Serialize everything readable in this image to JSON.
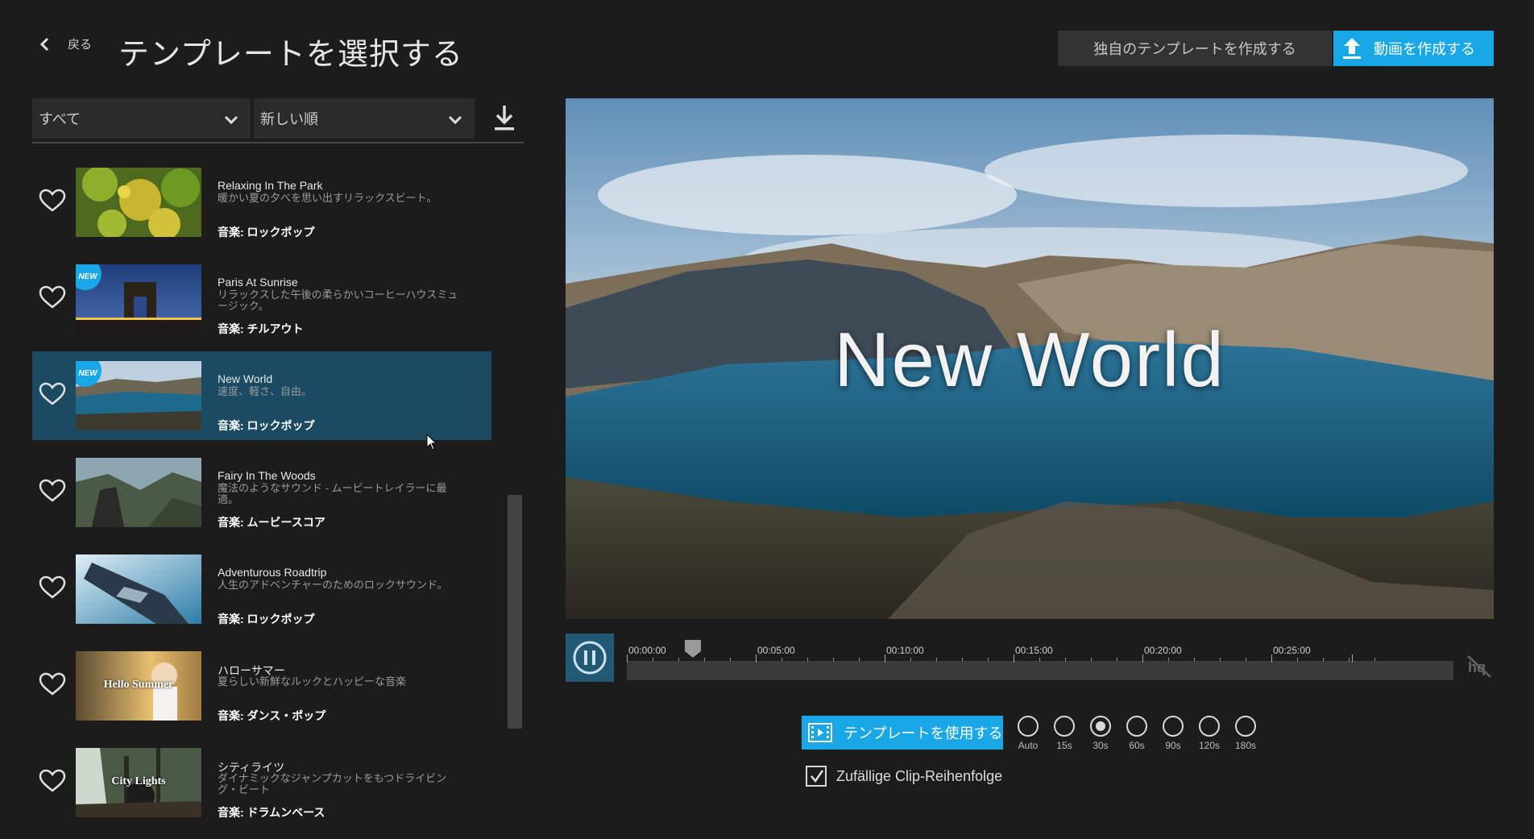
{
  "header": {
    "back_label": "戻る",
    "title": "テンプレートを選択する",
    "own_template_button": "独自のテンプレートを作成する",
    "create_video_button": "動画を作成する"
  },
  "filters": {
    "category": "すべて",
    "sort": "新しい順"
  },
  "templates": [
    {
      "name": "Relaxing In The Park",
      "desc": "暖かい夏の夕べを思い出すリラックスビート。",
      "music": "音楽: ロックポップ",
      "is_new": false,
      "selected": false,
      "thumb_text": ""
    },
    {
      "name": "Paris At Sunrise",
      "desc": "リラックスした午後の柔らかいコーヒーハウスミュージック。",
      "music": "音楽: チルアウト",
      "is_new": true,
      "selected": false,
      "thumb_text": ""
    },
    {
      "name": "New World",
      "desc": "速度、軽さ、自由。",
      "music": "音楽: ロックポップ",
      "is_new": true,
      "selected": true,
      "thumb_text": ""
    },
    {
      "name": "Fairy In The Woods",
      "desc": "魔法のようなサウンド - ムービートレイラーに最適。",
      "music": "音楽: ムービースコア",
      "is_new": false,
      "selected": false,
      "thumb_text": ""
    },
    {
      "name": "Adventurous Roadtrip",
      "desc": "人生のアドベンチャーのためのロックサウンド。",
      "music": "音楽: ロックポップ",
      "is_new": false,
      "selected": false,
      "thumb_text": ""
    },
    {
      "name": "ハローサマー",
      "desc": "夏らしい新鮮なルックとハッピーな音楽",
      "music": "音楽: ダンス・ポップ",
      "is_new": false,
      "selected": false,
      "thumb_text": "Hello Summer"
    },
    {
      "name": "シティライツ",
      "desc": "ダイナミックなジャンプカットをもつドライビング・ビート",
      "music": "音楽: ドラムンベース",
      "is_new": false,
      "selected": false,
      "thumb_text": "City Lights"
    }
  ],
  "new_badge": "NEW",
  "preview": {
    "title": "New World"
  },
  "timeline": {
    "labels": [
      "00:00:00",
      "00:05:00",
      "00:10:00",
      "00:15:00",
      "00:20:00",
      "00:25:00"
    ],
    "playhead_fraction": 0.07
  },
  "options": {
    "use_template_button": "テンプレートを使用する",
    "durations": [
      {
        "label": "Auto",
        "selected": false
      },
      {
        "label": "15s",
        "selected": false
      },
      {
        "label": "30s",
        "selected": true
      },
      {
        "label": "60s",
        "selected": false
      },
      {
        "label": "90s",
        "selected": false
      },
      {
        "label": "120s",
        "selected": false
      },
      {
        "label": "180s",
        "selected": false
      }
    ],
    "shuffle_label": "Zufällige Clip-Reihenfolge",
    "shuffle_checked": true
  },
  "colors": {
    "accent": "#1aa7e8",
    "selected_row": "#1b4a63",
    "background": "#1c1c1c"
  }
}
